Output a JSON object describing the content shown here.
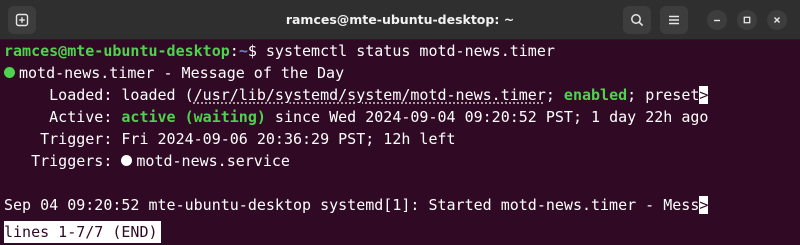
{
  "window": {
    "title": "ramces@mte-ubuntu-desktop: ~"
  },
  "icons": {
    "new_tab": "new-tab-icon",
    "search": "search-icon",
    "menu": "hamburger-menu-icon",
    "minimize": "minimize-icon",
    "maximize": "maximize-icon",
    "close": "close-icon"
  },
  "colors": {
    "terminal_bg": "#300a24",
    "titlebar_bg": "#2f2f2f",
    "prompt_green": "#4ed34e",
    "prompt_blue": "#6d86c4",
    "text": "#ffffff"
  },
  "terminal": {
    "prompt_user_host": "ramces@mte-ubuntu-desktop",
    "prompt_sep": ":",
    "prompt_dir": "~",
    "prompt_symbol": "$ ",
    "command": "systemctl status motd-news.timer",
    "unit_line": "motd-news.timer - Message of the Day",
    "loaded_label": "     Loaded: ",
    "loaded_value": "loaded (",
    "loaded_path": "/usr/lib/systemd/system/motd-news.timer",
    "loaded_sep": "; ",
    "loaded_enabled": "enabled",
    "loaded_rest": "; preset",
    "truncation_mark": ">",
    "active_label": "     Active: ",
    "active_state": "active (waiting)",
    "active_rest": " since Wed 2024-09-04 09:20:52 PST; 1 day 22h ago",
    "trigger_label": "    Trigger: ",
    "trigger_value": "Fri 2024-09-06 20:36:29 PST; 12h left",
    "triggers_label": "   Triggers: ",
    "triggers_value": "motd-news.service",
    "log_line": "Sep 04 09:20:52 mte-ubuntu-desktop systemd[1]: Started motd-news.timer - Mess",
    "pager_status": "lines 1-7/7 (END)"
  }
}
